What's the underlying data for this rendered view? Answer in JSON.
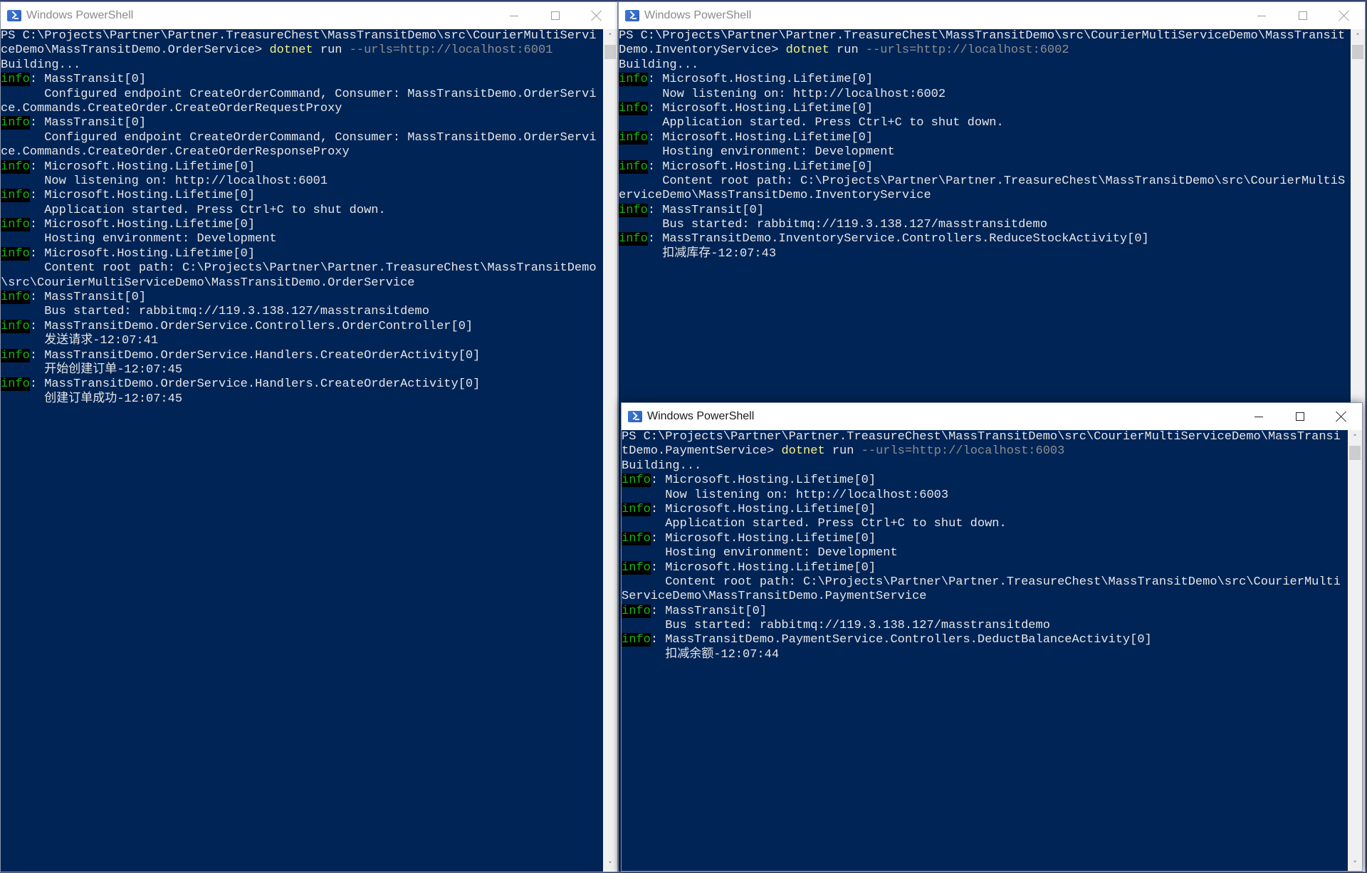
{
  "windows": [
    {
      "id": "order",
      "title": "Windows PowerShell",
      "lines": [
        [
          {
            "t": "PS C:\\Projects\\Partner\\Partner.TreasureChest\\MassTransitDemo\\src\\CourierMultiServi"
          }
        ],
        [
          {
            "t": "ceDemo\\MassTransitDemo.OrderService> "
          },
          {
            "t": "dotnet",
            "c": "cmd"
          },
          {
            "t": " run "
          },
          {
            "t": "--urls=http://localhost:6001",
            "c": "arg"
          }
        ],
        [
          {
            "t": "Building..."
          }
        ],
        [
          {
            "t": "info",
            "c": "tag"
          },
          {
            "t": ": MassTransit[0]"
          }
        ],
        [
          {
            "t": "      Configured endpoint CreateOrderCommand, Consumer: MassTransitDemo.OrderServi"
          }
        ],
        [
          {
            "t": "ce.Commands.CreateOrder.CreateOrderRequestProxy"
          }
        ],
        [
          {
            "t": "info",
            "c": "tag"
          },
          {
            "t": ": MassTransit[0]"
          }
        ],
        [
          {
            "t": "      Configured endpoint CreateOrderCommand, Consumer: MassTransitDemo.OrderServi"
          }
        ],
        [
          {
            "t": "ce.Commands.CreateOrder.CreateOrderResponseProxy"
          }
        ],
        [
          {
            "t": "info",
            "c": "tag"
          },
          {
            "t": ": Microsoft.Hosting.Lifetime[0]"
          }
        ],
        [
          {
            "t": "      Now listening on: http://localhost:6001"
          }
        ],
        [
          {
            "t": "info",
            "c": "tag"
          },
          {
            "t": ": Microsoft.Hosting.Lifetime[0]"
          }
        ],
        [
          {
            "t": "      Application started. Press Ctrl+C to shut down."
          }
        ],
        [
          {
            "t": "info",
            "c": "tag"
          },
          {
            "t": ": Microsoft.Hosting.Lifetime[0]"
          }
        ],
        [
          {
            "t": "      Hosting environment: Development"
          }
        ],
        [
          {
            "t": "info",
            "c": "tag"
          },
          {
            "t": ": Microsoft.Hosting.Lifetime[0]"
          }
        ],
        [
          {
            "t": "      Content root path: C:\\Projects\\Partner\\Partner.TreasureChest\\MassTransitDemo"
          }
        ],
        [
          {
            "t": "\\src\\CourierMultiServiceDemo\\MassTransitDemo.OrderService"
          }
        ],
        [
          {
            "t": "info",
            "c": "tag"
          },
          {
            "t": ": MassTransit[0]"
          }
        ],
        [
          {
            "t": "      Bus started: rabbitmq://119.3.138.127/masstransitdemo"
          }
        ],
        [
          {
            "t": "info",
            "c": "tag"
          },
          {
            "t": ": MassTransitDemo.OrderService.Controllers.OrderController[0]"
          }
        ],
        [
          {
            "t": "      发送请求-12:07:41"
          }
        ],
        [
          {
            "t": "info",
            "c": "tag"
          },
          {
            "t": ": MassTransitDemo.OrderService.Handlers.CreateOrderActivity[0]"
          }
        ],
        [
          {
            "t": "      开始创建订单-12:07:45"
          }
        ],
        [
          {
            "t": "info",
            "c": "tag"
          },
          {
            "t": ": MassTransitDemo.OrderService.Handlers.CreateOrderActivity[0]"
          }
        ],
        [
          {
            "t": "      创建订单成功-12:07:45"
          }
        ]
      ]
    },
    {
      "id": "inventory",
      "title": "Windows PowerShell",
      "lines": [
        [
          {
            "t": "PS C:\\Projects\\Partner\\Partner.TreasureChest\\MassTransitDemo\\src\\CourierMultiServiceDemo\\MassTransit"
          }
        ],
        [
          {
            "t": "Demo.InventoryService> "
          },
          {
            "t": "dotnet",
            "c": "cmd"
          },
          {
            "t": " run "
          },
          {
            "t": "--urls=http://localhost:6002",
            "c": "arg"
          }
        ],
        [
          {
            "t": "Building..."
          }
        ],
        [
          {
            "t": "info",
            "c": "tag"
          },
          {
            "t": ": Microsoft.Hosting.Lifetime[0]"
          }
        ],
        [
          {
            "t": "      Now listening on: http://localhost:6002"
          }
        ],
        [
          {
            "t": "info",
            "c": "tag"
          },
          {
            "t": ": Microsoft.Hosting.Lifetime[0]"
          }
        ],
        [
          {
            "t": "      Application started. Press Ctrl+C to shut down."
          }
        ],
        [
          {
            "t": "info",
            "c": "tag"
          },
          {
            "t": ": Microsoft.Hosting.Lifetime[0]"
          }
        ],
        [
          {
            "t": "      Hosting environment: Development"
          }
        ],
        [
          {
            "t": "info",
            "c": "tag"
          },
          {
            "t": ": Microsoft.Hosting.Lifetime[0]"
          }
        ],
        [
          {
            "t": "      Content root path: C:\\Projects\\Partner\\Partner.TreasureChest\\MassTransitDemo\\src\\CourierMultiS"
          }
        ],
        [
          {
            "t": "erviceDemo\\MassTransitDemo.InventoryService"
          }
        ],
        [
          {
            "t": "info",
            "c": "tag"
          },
          {
            "t": ": MassTransit[0]"
          }
        ],
        [
          {
            "t": "      Bus started: rabbitmq://119.3.138.127/masstransitdemo"
          }
        ],
        [
          {
            "t": "info",
            "c": "tag"
          },
          {
            "t": ": MassTransitDemo.InventoryService.Controllers.ReduceStockActivity[0]"
          }
        ],
        [
          {
            "t": "      扣减库存-12:07:43"
          }
        ]
      ]
    },
    {
      "id": "payment",
      "title": "Windows PowerShell",
      "lines": [
        [
          {
            "t": "PS C:\\Projects\\Partner\\Partner.TreasureChest\\MassTransitDemo\\src\\CourierMultiServiceDemo\\MassTransi"
          }
        ],
        [
          {
            "t": "tDemo.PaymentService> "
          },
          {
            "t": "dotnet",
            "c": "cmd"
          },
          {
            "t": " run "
          },
          {
            "t": "--urls=http://localhost:6003",
            "c": "arg"
          }
        ],
        [
          {
            "t": "Building..."
          }
        ],
        [
          {
            "t": "info",
            "c": "tag"
          },
          {
            "t": ": Microsoft.Hosting.Lifetime[0]"
          }
        ],
        [
          {
            "t": "      Now listening on: http://localhost:6003"
          }
        ],
        [
          {
            "t": "info",
            "c": "tag"
          },
          {
            "t": ": Microsoft.Hosting.Lifetime[0]"
          }
        ],
        [
          {
            "t": "      Application started. Press Ctrl+C to shut down."
          }
        ],
        [
          {
            "t": "info",
            "c": "tag"
          },
          {
            "t": ": Microsoft.Hosting.Lifetime[0]"
          }
        ],
        [
          {
            "t": "      Hosting environment: Development"
          }
        ],
        [
          {
            "t": "info",
            "c": "tag"
          },
          {
            "t": ": Microsoft.Hosting.Lifetime[0]"
          }
        ],
        [
          {
            "t": "      Content root path: C:\\Projects\\Partner\\Partner.TreasureChest\\MassTransitDemo\\src\\CourierMulti"
          }
        ],
        [
          {
            "t": "ServiceDemo\\MassTransitDemo.PaymentService"
          }
        ],
        [
          {
            "t": "info",
            "c": "tag"
          },
          {
            "t": ": MassTransit[0]"
          }
        ],
        [
          {
            "t": "      Bus started: rabbitmq://119.3.138.127/masstransitdemo"
          }
        ],
        [
          {
            "t": "info",
            "c": "tag"
          },
          {
            "t": ": MassTransitDemo.PaymentService.Controllers.DeductBalanceActivity[0]"
          }
        ],
        [
          {
            "t": "      扣减余额-12:07:44"
          }
        ]
      ]
    }
  ],
  "icons": {
    "scroll_up": "˄",
    "scroll_down": "˅"
  },
  "colors": {
    "console_bg": "#012456",
    "info_tag": "#12b812",
    "command": "#f2f287",
    "argument": "#8e8e8e",
    "text": "#e6e6e6"
  }
}
